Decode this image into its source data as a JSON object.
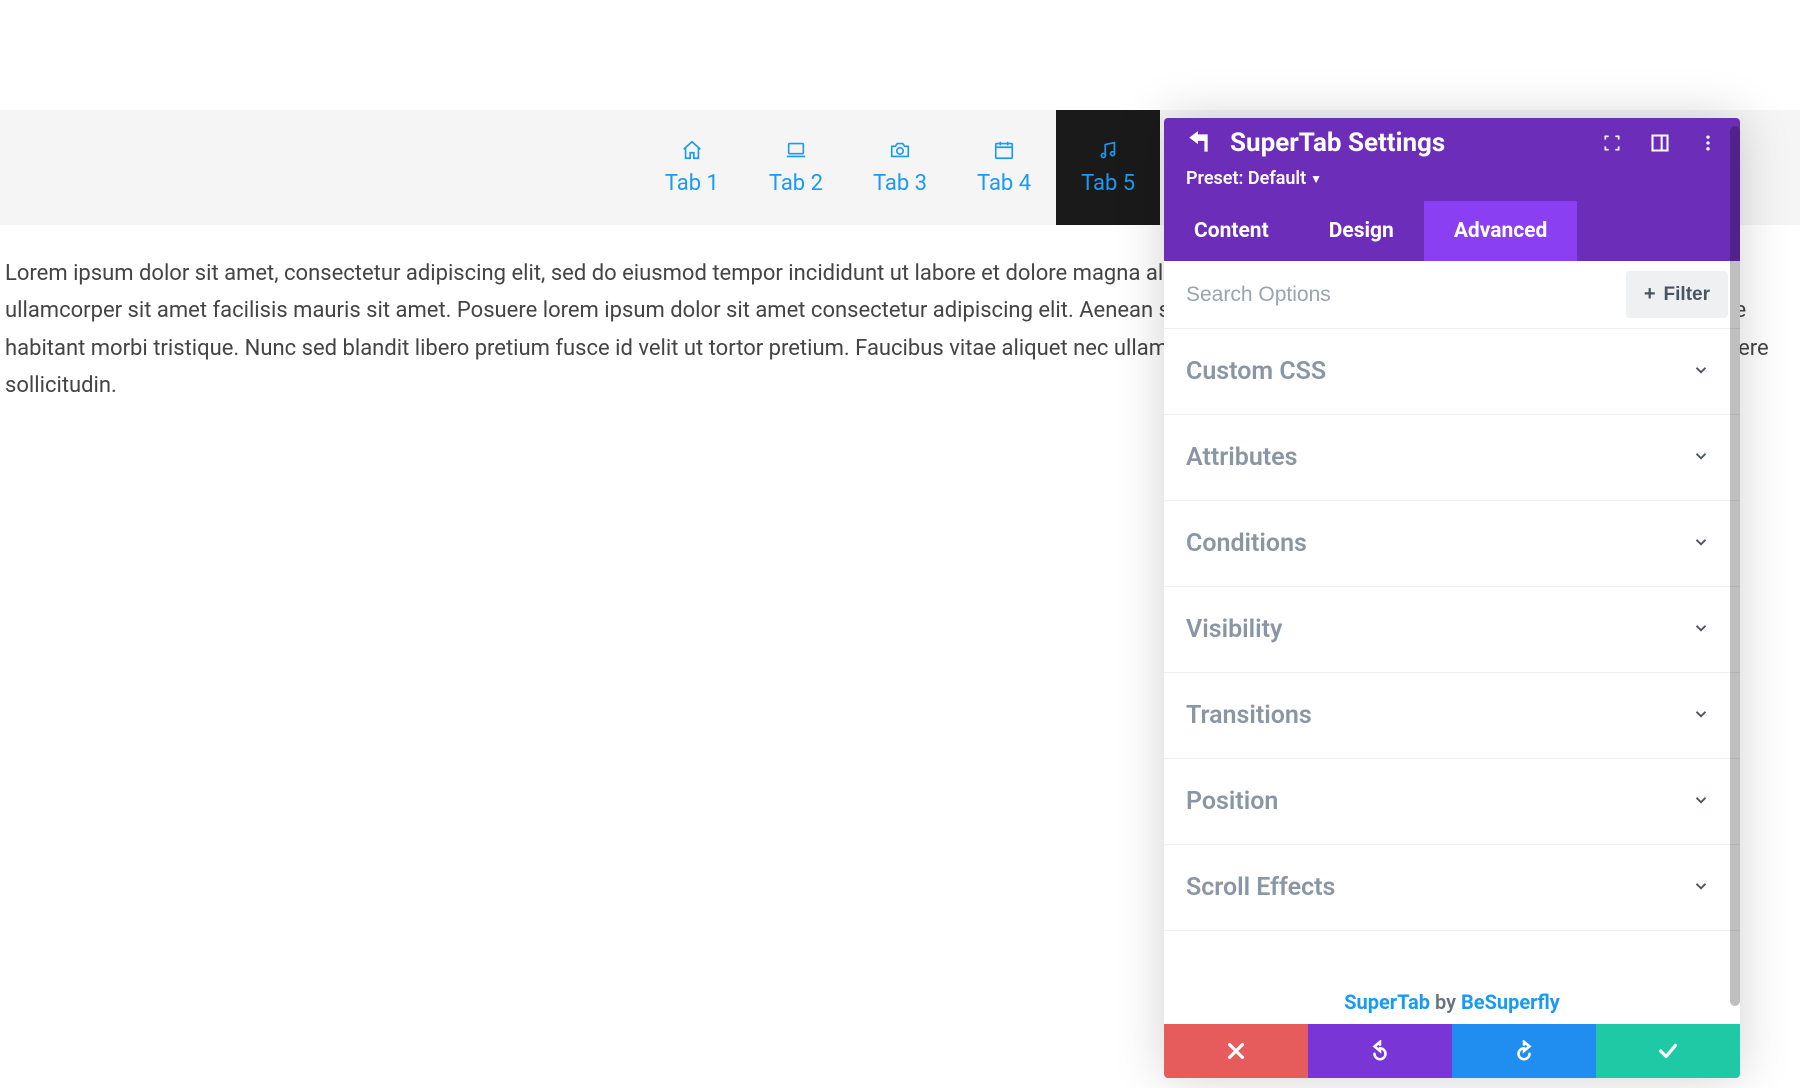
{
  "tabs": [
    {
      "label": "Tab 1",
      "icon": "home"
    },
    {
      "label": "Tab 2",
      "icon": "laptop"
    },
    {
      "label": "Tab 3",
      "icon": "camera"
    },
    {
      "label": "Tab 4",
      "icon": "calendar"
    },
    {
      "label": "Tab 5",
      "icon": "music",
      "active": true
    }
  ],
  "body_text": "Lorem ipsum dolor sit amet, consectetur adipiscing elit, sed do eiusmod tempor incididunt ut labore et dolore magna aliqua. At tellus at urna condimentum mattis. Aliquet nec ullamcorper sit amet facilisis mauris sit amet. Posuere lorem ipsum dolor sit amet consectetur adipiscing elit. Aenean sed adipiscing diam donec adipiscing. Pulvinar pellentesque habitant morbi tristique. Nunc sed blandit libero pretium fusce id velit ut tortor pretium. Faucibus vitae aliquet nec ullamcorper sit amet risus nullam eget. Eleifend mi in nulla posuere sollicitudin.",
  "panel": {
    "title": "SuperTab Settings",
    "preset_label": "Preset: Default",
    "tabs": [
      {
        "label": "Content"
      },
      {
        "label": "Design"
      },
      {
        "label": "Advanced",
        "active": true
      }
    ],
    "search_placeholder": "Search Options",
    "filter_label": "Filter",
    "options": [
      {
        "label": "Custom CSS"
      },
      {
        "label": "Attributes"
      },
      {
        "label": "Conditions"
      },
      {
        "label": "Visibility"
      },
      {
        "label": "Transitions"
      },
      {
        "label": "Position"
      },
      {
        "label": "Scroll Effects"
      }
    ],
    "credit": {
      "product": "SuperTab",
      "by": " by ",
      "company": "BeSuperfly"
    }
  }
}
